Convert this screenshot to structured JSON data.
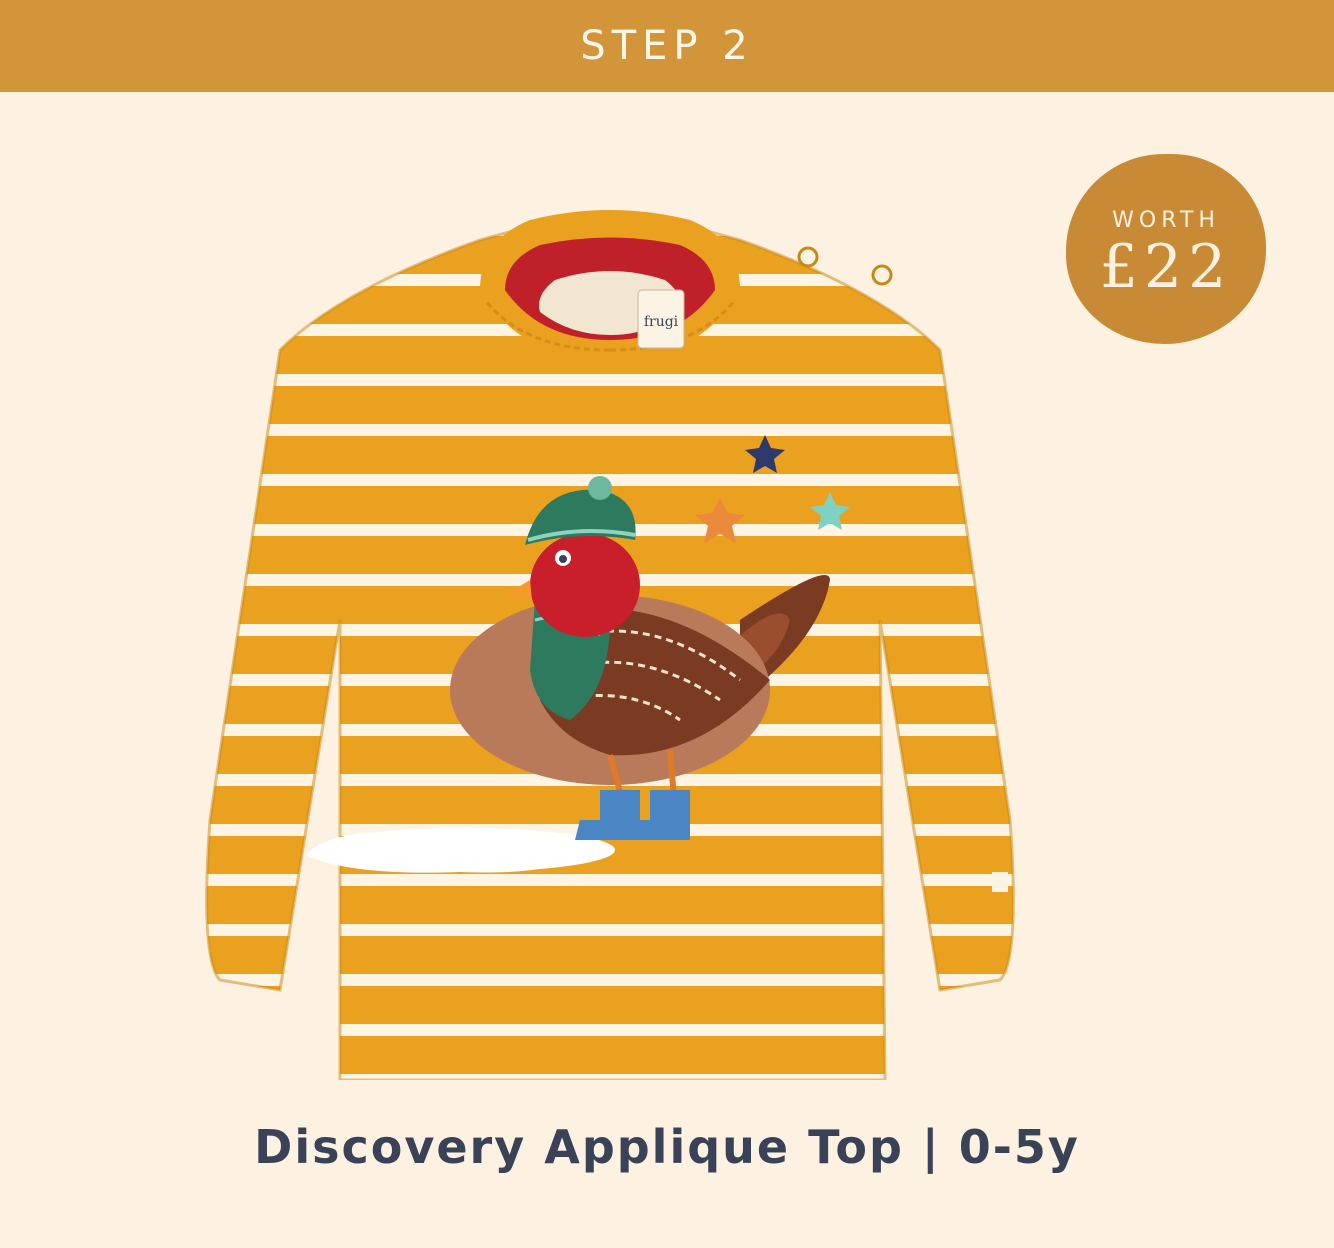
{
  "banner": {
    "label": "STEP 2"
  },
  "badge": {
    "label": "WORTH",
    "price": "£22"
  },
  "product": {
    "title": "Discovery Applique Top | 0-5y",
    "brand_tag": "frugi",
    "image_icon": "striped-long-sleeve-top-with-robin-applique",
    "colors": {
      "body": "#eaa11f",
      "stripe": "#fdf4e3",
      "collar_inner": "#c0202a"
    }
  },
  "colors": {
    "banner": "#d39539",
    "background": "#fdf1e2",
    "badge": "#c88a35",
    "title": "#3a4257"
  }
}
